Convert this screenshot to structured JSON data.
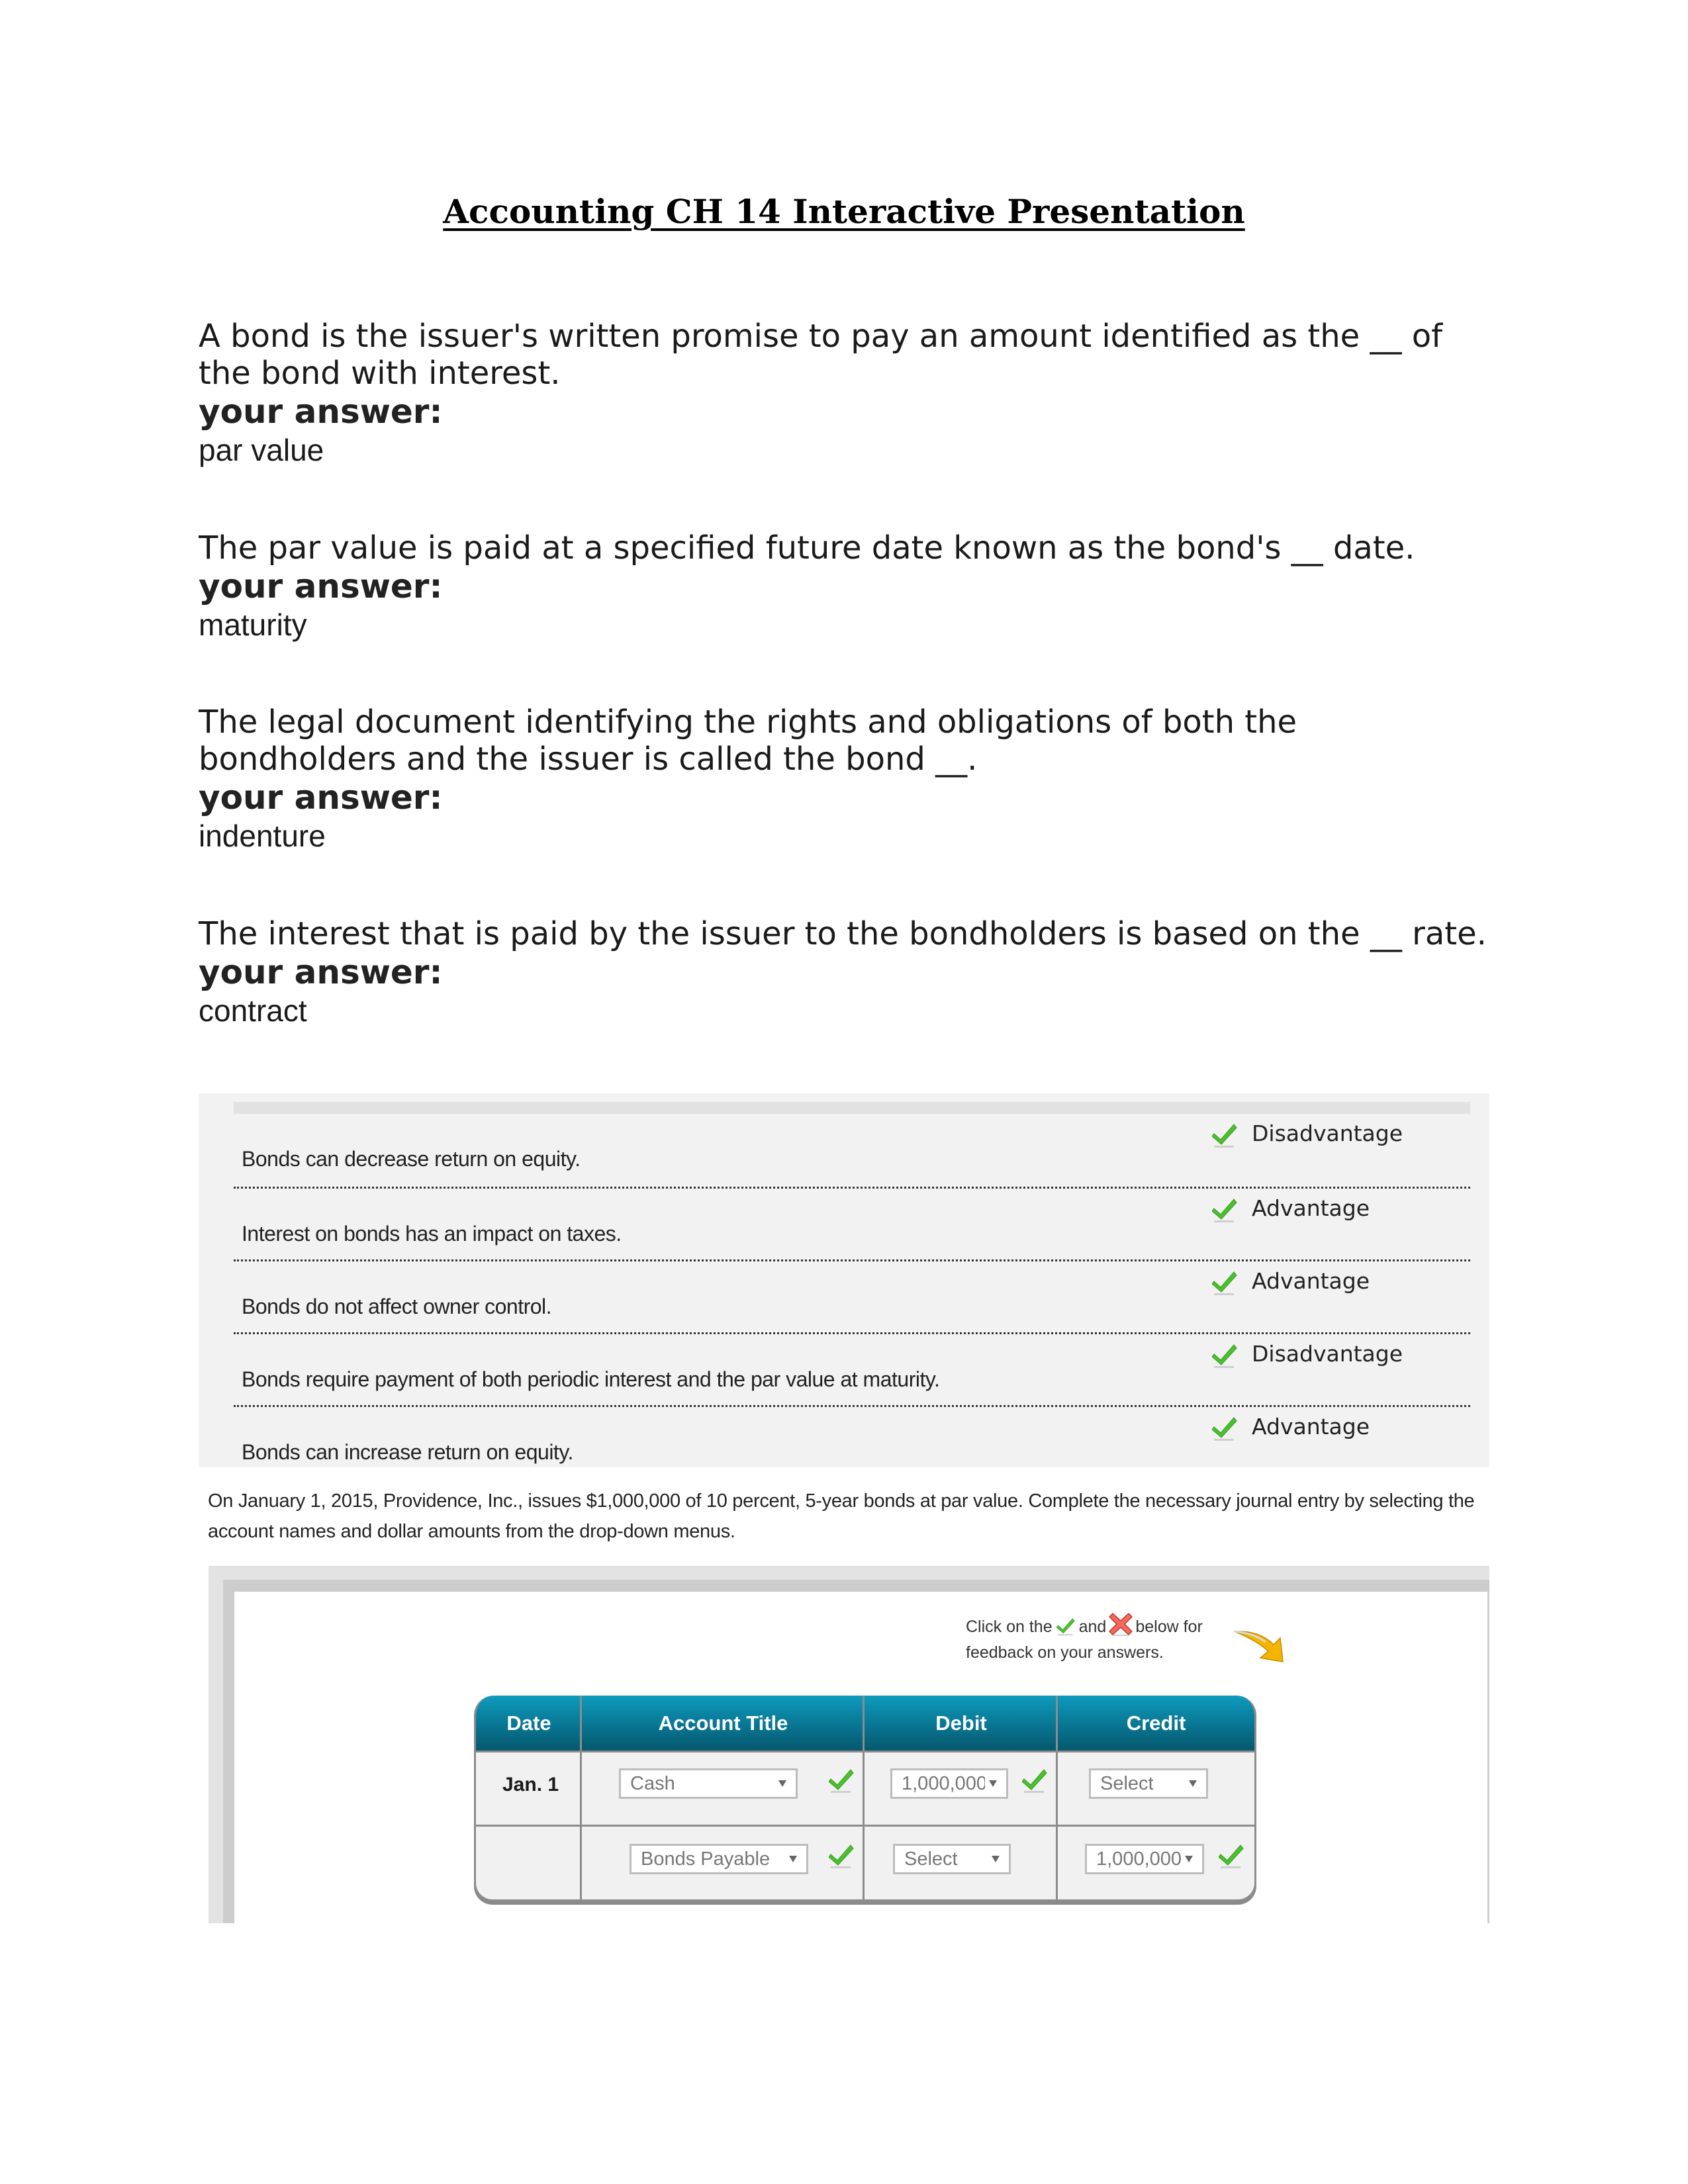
{
  "document": {
    "title": "Accounting CH 14 Interactive Presentation"
  },
  "questions": [
    {
      "prompt": "A bond is the issuer's written promise to pay an amount identified as the __ of the bond with interest.",
      "answer_label": "your answer:",
      "answer": "par value"
    },
    {
      "prompt": "The par value is paid at a specified future date known as the bond's __ date.",
      "answer_label": "your answer:",
      "answer": "maturity"
    },
    {
      "prompt": "The legal document identifying the rights and obligations of both the bondholders and the issuer is called the bond __.",
      "answer_label": "your answer:",
      "answer": "indenture"
    },
    {
      "prompt": "The interest that is paid by the issuer to the bondholders is based on the __ rate.",
      "answer_label": "your answer:",
      "answer": "contract"
    }
  ],
  "classification": {
    "rows": [
      {
        "statement": "Bonds can decrease return on equity.",
        "answer": "Disadvantage",
        "status": "correct"
      },
      {
        "statement": "Interest on bonds has an impact on taxes.",
        "answer": "Advantage",
        "status": "correct"
      },
      {
        "statement": "Bonds do not affect owner control.",
        "answer": "Advantage",
        "status": "correct"
      },
      {
        "statement": "Bonds require payment of both periodic interest and the par value at maturity.",
        "answer": "Disadvantage",
        "status": "correct"
      },
      {
        "statement": "Bonds can increase return on equity.",
        "answer": "Advantage",
        "status": "correct"
      }
    ]
  },
  "journal_entry": {
    "instruction": "On January 1, 2015, Providence, Inc., issues $1,000,000 of 10 percent, 5-year bonds at par value. Complete the necessary journal entry by selecting the account names and dollar amounts from the drop-down menus.",
    "feedback_note": {
      "part1": "Click on the",
      "part2": "and",
      "part3": "below for",
      "part4": "feedback on your answers."
    },
    "columns": [
      "Date",
      "Account Title",
      "Debit",
      "Credit"
    ],
    "rows": [
      {
        "date": "Jan. 1",
        "account": "Cash",
        "debit": "1,000,000",
        "credit": "Select",
        "account_status": "correct",
        "debit_status": "correct"
      },
      {
        "date": "",
        "account": "Bonds Payable",
        "debit": "Select",
        "credit": "1,000,000",
        "account_status": "correct",
        "credit_status": "correct"
      }
    ]
  },
  "colors": {
    "check_green": "#4cc12e",
    "header_teal": "#0a7d9a",
    "panel_gray": "#f2f2f2",
    "cross_red": "#e0403a",
    "arrow_yellow": "#f5b400"
  }
}
